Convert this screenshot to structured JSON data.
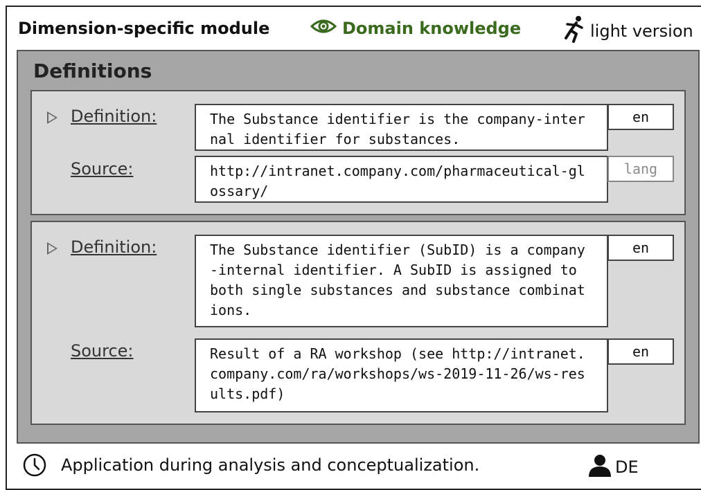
{
  "header": {
    "module_label": "Dimension-specific module",
    "domain_label": "Domain knowledge",
    "light_label": "light version",
    "icons": {
      "eye": "eye-icon",
      "runner": "running-person-icon"
    }
  },
  "definitions": {
    "title": "Definitions",
    "entries": [
      {
        "definition_label": "Definition:",
        "definition_text": "The Substance identifier is the company-internal identifier for substances.",
        "definition_lang": "en",
        "source_label": "Source:",
        "source_text": "http://intranet.company.com/pharmaceutical-glossary/",
        "source_lang_placeholder": "lang"
      },
      {
        "definition_label": "Definition:",
        "definition_text": "The Substance identifier (SubID) is a company-internal identifier. A SubID is assigned to both single substances and substance combinations.",
        "definition_lang": "en",
        "source_label": "Source:",
        "source_text": "Result of a RA workshop (see http://intranet.company.com/ra/workshops/ws-2019-11-26/ws-results.pdf)",
        "source_lang": "en"
      }
    ]
  },
  "footer": {
    "application_text": "Application during analysis and conceptualization.",
    "user_label": "DE",
    "icons": {
      "clock": "clock-icon",
      "user": "user-icon"
    }
  },
  "colors": {
    "domain": "#3a6a1e",
    "panel": "#a6a6a6",
    "card": "#d9d9d9"
  }
}
